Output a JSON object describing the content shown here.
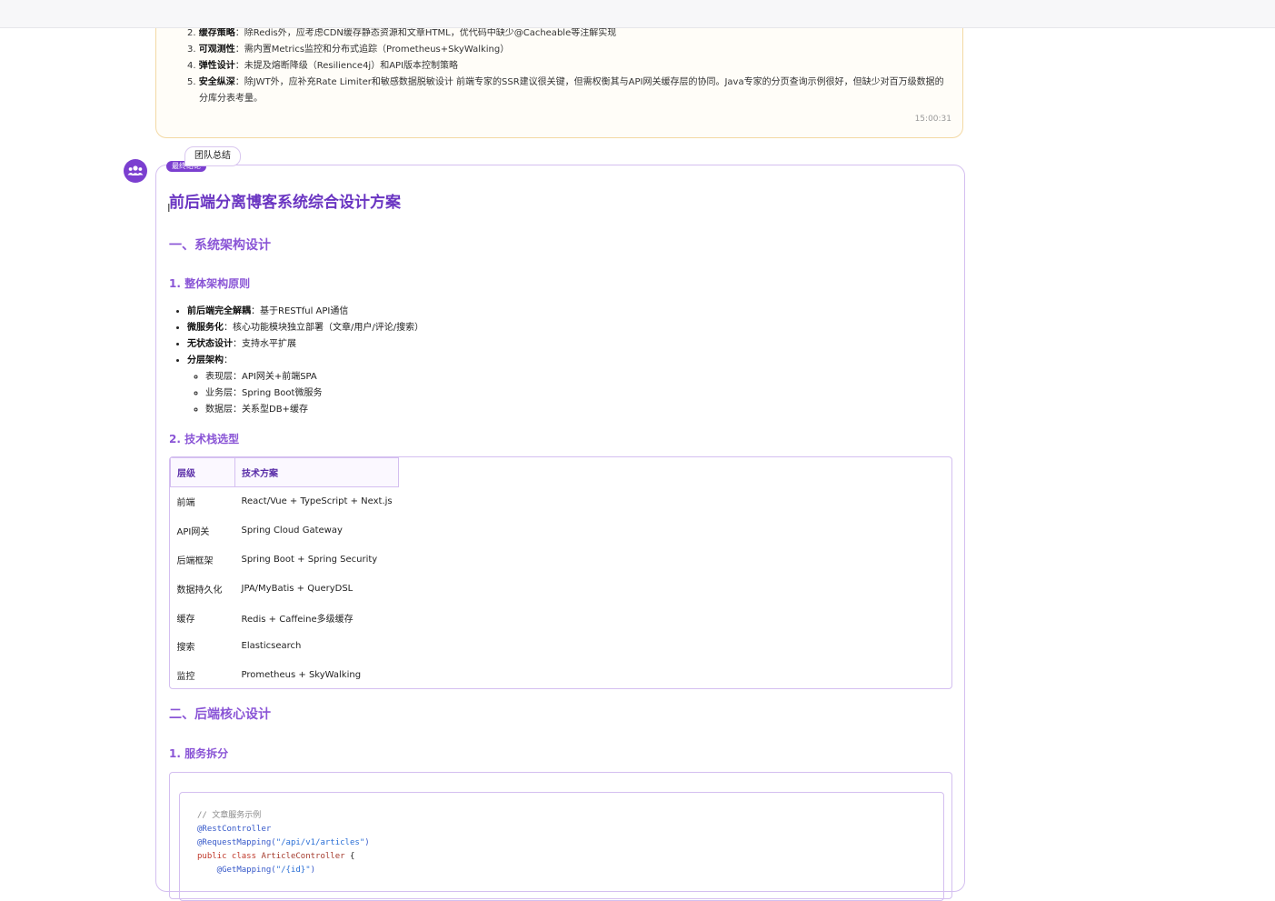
{
  "previous_message": {
    "items": [
      {
        "num": "2.",
        "label": "缓存策略",
        "text": "：除Redis外，应考虑CDN缓存静态资源和文章HTML，优代码中缺少@Cacheable等注解实现"
      },
      {
        "num": "3.",
        "label": "可观测性",
        "text": "：需内置Metrics监控和分布式追踪（Prometheus+SkyWalking）"
      },
      {
        "num": "4.",
        "label": "弹性设计",
        "text": "：未提及熔断降级（Resilience4j）和API版本控制策略"
      },
      {
        "num": "5.",
        "label": "安全纵深",
        "text": "：除JWT外，应补充Rate Limiter和敏感数据脱敏设计 前端专家的SSR建议很关键，但需权衡其与API网关缓存层的协同。Java专家的分页查询示例很好，但缺少对百万级数据的分库分表考量。"
      }
    ],
    "time": "15:00:31"
  },
  "message": {
    "sender": "团队总结",
    "badge": "最终结论",
    "title": "前后端分离博客系统综合设计方案",
    "section1": "一、系统架构设计",
    "sub1": "1. 整体架构原则",
    "principles": [
      {
        "label": "前后端完全解耦",
        "text": "：基于RESTful API通信"
      },
      {
        "label": "微服务化",
        "text": "：核心功能模块独立部署（文章/用户/评论/搜索）"
      },
      {
        "label": "无状态设计",
        "text": "：支持水平扩展"
      },
      {
        "label": "分层架构",
        "text": "："
      }
    ],
    "layers": [
      "表现层：API网关+前端SPA",
      "业务层：Spring Boot微服务",
      "数据层：关系型DB+缓存"
    ],
    "sub2": "2. 技术栈选型",
    "table": {
      "headers": [
        "层级",
        "技术方案"
      ],
      "rows": [
        [
          "前端",
          "React/Vue + TypeScript + Next.js"
        ],
        [
          "API网关",
          "Spring Cloud Gateway"
        ],
        [
          "后端框架",
          "Spring Boot + Spring Security"
        ],
        [
          "数据持久化",
          "JPA/MyBatis + QueryDSL"
        ],
        [
          "缓存",
          "Redis + Caffeine多级缓存"
        ],
        [
          "搜索",
          "Elasticsearch"
        ],
        [
          "监控",
          "Prometheus + SkyWalking"
        ]
      ]
    },
    "section2": "二、后端核心设计",
    "sub3": "1. 服务拆分",
    "code": {
      "comment": "// 文章服务示例",
      "anno1": "@RestController",
      "anno2_name": "@RequestMapping(",
      "anno2_str": "\"/api/v1/articles\"",
      "anno2_close": ")",
      "kw": "public class",
      "cls": " ArticleController",
      "brace": " {",
      "anno3_name": "    @GetMapping(",
      "anno3_str": "\"/{id}\"",
      "anno3_close": ")"
    }
  },
  "colors": {
    "accent": "#7b3fd0",
    "title": "#6a35c2",
    "heading": "#8a55d6",
    "card_border": "#d4bff0",
    "prev_border": "#f3d9a4"
  },
  "icons": {
    "avatar": "team-icon"
  }
}
